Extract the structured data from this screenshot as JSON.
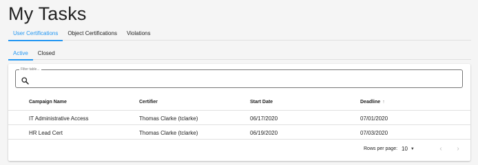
{
  "page": {
    "title": "My Tasks"
  },
  "tabs": [
    {
      "label": "User Certifications",
      "active": true
    },
    {
      "label": "Object Certifications",
      "active": false
    },
    {
      "label": "Violations",
      "active": false
    }
  ],
  "subtabs": [
    {
      "label": "Active",
      "active": true
    },
    {
      "label": "Closed",
      "active": false
    }
  ],
  "filter": {
    "label": "Filter table...",
    "value": "",
    "icon": "search-icon"
  },
  "table": {
    "columns": [
      "Campaign Name",
      "Certifier",
      "Start Date",
      "Deadline"
    ],
    "sort_indicator": "↑",
    "rows": [
      [
        "IT Administrative Access",
        "Thomas Clarke (tclarke)",
        "06/17/2020",
        "07/01/2020"
      ],
      [
        "HR Lead Cert",
        "Thomas Clarke (tclarke)",
        "06/19/2020",
        "07/03/2020"
      ]
    ]
  },
  "pagination": {
    "rows_per_page_label": "Rows per page:",
    "rows_per_page_value": "10",
    "caret": "▼",
    "prev": "‹",
    "next": "›"
  },
  "colors": {
    "accent": "#2196f3",
    "background": "#f5f5f5",
    "card": "#ffffff"
  }
}
